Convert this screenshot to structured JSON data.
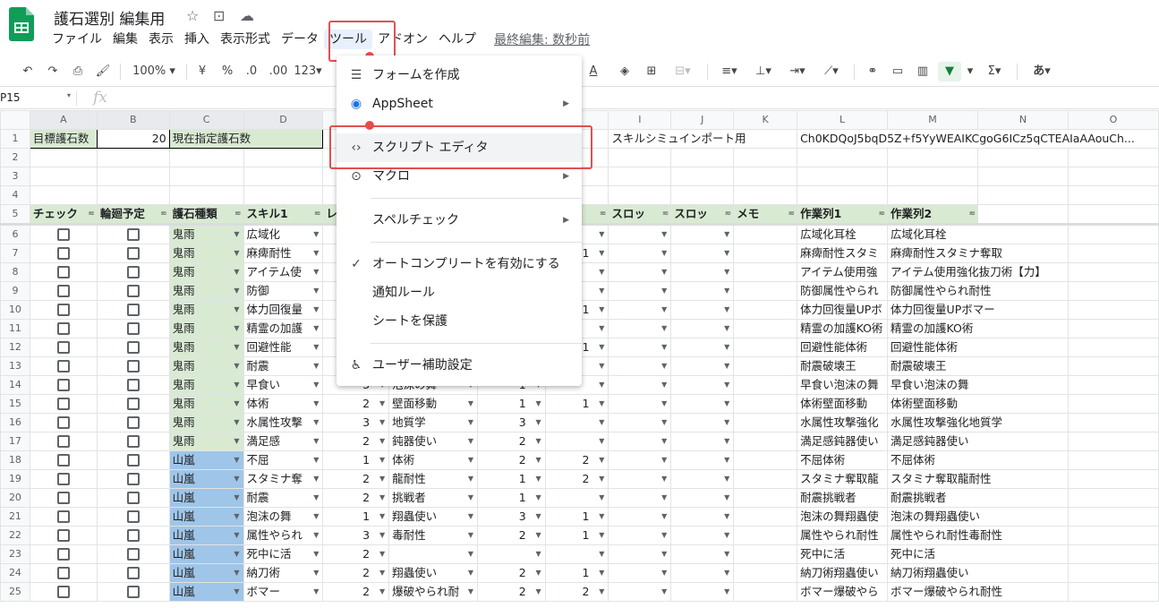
{
  "app": {
    "title": "護石選別 編集用",
    "last_edit": "最終編集: 数秒前"
  },
  "menubar": [
    "ファイル",
    "編集",
    "表示",
    "挿入",
    "表示形式",
    "データ",
    "ツール",
    "アドオン",
    "ヘルプ"
  ],
  "toolbar": {
    "zoom": "100%",
    "currency": "¥",
    "percent": "%",
    "dec_less": ".0",
    "dec_more": ".00",
    "format_more": "123",
    "ime": "あ"
  },
  "formula_bar": {
    "cell_ref": "P15",
    "fx": "fx"
  },
  "columns": [
    "A",
    "B",
    "C",
    "D",
    "E",
    "F",
    "G",
    "H",
    "I",
    "J",
    "K",
    "L",
    "M",
    "N",
    "O"
  ],
  "top_rows": {
    "r1": {
      "a": "目標護石数",
      "b": "20",
      "c": "現在指定護石数",
      "i": "スキルシミュインポート用",
      "l": "Ch0KDQoJ5bqD5Z+f5YyWEAIKCgoG6ICz5qCTEAIaAAouCh..."
    }
  },
  "header_row": [
    "チェック",
    "輪廻予定",
    "護石種類",
    "スキル1",
    "レ",
    "",
    "",
    "ト",
    "スロッ",
    "スロッ",
    "メモ",
    "作業列1",
    "作業列2"
  ],
  "rows": [
    {
      "n": "6",
      "type": "鬼雨",
      "s1": "広域化",
      "l1": "",
      "s2": "",
      "l2": "",
      "l3": "",
      "w1": "広域化耳栓",
      "w2": "広域化耳栓"
    },
    {
      "n": "7",
      "type": "鬼雨",
      "s1": "麻痺耐性",
      "l1": "",
      "s2": "",
      "l2": "",
      "l3": "1",
      "w1": "麻痺耐性スタミ",
      "w2": "麻痺耐性スタミナ奪取"
    },
    {
      "n": "8",
      "type": "鬼雨",
      "s1": "アイテム使",
      "l1": "",
      "s2": "",
      "l2": "",
      "l3": "",
      "w1": "アイテム使用強",
      "w2": "アイテム使用強化抜刀術【力】"
    },
    {
      "n": "9",
      "type": "鬼雨",
      "s1": "防御",
      "l1": "",
      "s2": "",
      "l2": "",
      "l3": "",
      "w1": "防御属性やられ",
      "w2": "防御属性やられ耐性"
    },
    {
      "n": "10",
      "type": "鬼雨",
      "s1": "体力回復量",
      "l1": "",
      "s2": "",
      "l2": "",
      "l3": "1",
      "w1": "体力回復量UPボ",
      "w2": "体力回復量UPボマー"
    },
    {
      "n": "11",
      "type": "鬼雨",
      "s1": "精霊の加護",
      "l1": "",
      "s2": "",
      "l2": "",
      "l3": "",
      "w1": "精霊の加護KO術",
      "w2": "精霊の加護KO術"
    },
    {
      "n": "12",
      "type": "鬼雨",
      "s1": "回避性能",
      "l1": "",
      "s2": "",
      "l2": "",
      "l3": "1",
      "w1": "回避性能体術",
      "w2": "回避性能体術"
    },
    {
      "n": "13",
      "type": "鬼雨",
      "s1": "耐震",
      "l1": "",
      "s2": "",
      "l2": "",
      "l3": "",
      "w1": "耐震破壊王",
      "w2": "耐震破壊王"
    },
    {
      "n": "14",
      "type": "鬼雨",
      "s1": "早食い",
      "l1": "3",
      "s2": "泡沫の舞",
      "l2": "1",
      "l3": "",
      "w1": "早食い泡沫の舞",
      "w2": "早食い泡沫の舞"
    },
    {
      "n": "15",
      "type": "鬼雨",
      "s1": "体術",
      "l1": "2",
      "s2": "壁面移動",
      "l2": "1",
      "l3": "1",
      "w1": "体術壁面移動",
      "w2": "体術壁面移動"
    },
    {
      "n": "16",
      "type": "鬼雨",
      "s1": "水属性攻撃",
      "l1": "3",
      "s2": "地質学",
      "l2": "3",
      "l3": "",
      "w1": "水属性攻撃強化",
      "w2": "水属性攻撃強化地質学"
    },
    {
      "n": "17",
      "type": "鬼雨",
      "s1": "満足感",
      "l1": "2",
      "s2": "鈍器使い",
      "l2": "2",
      "l3": "",
      "w1": "満足感鈍器使い",
      "w2": "満足感鈍器使い"
    },
    {
      "n": "18",
      "type": "山嵐",
      "s1": "不屈",
      "l1": "1",
      "s2": "体術",
      "l2": "2",
      "l3": "2",
      "w1": "不屈体術",
      "w2": "不屈体術"
    },
    {
      "n": "19",
      "type": "山嵐",
      "s1": "スタミナ奪",
      "l1": "2",
      "s2": "龍耐性",
      "l2": "1",
      "l3": "2",
      "w1": "スタミナ奪取龍",
      "w2": "スタミナ奪取龍耐性"
    },
    {
      "n": "20",
      "type": "山嵐",
      "s1": "耐震",
      "l1": "2",
      "s2": "挑戦者",
      "l2": "1",
      "l3": "",
      "w1": "耐震挑戦者",
      "w2": "耐震挑戦者"
    },
    {
      "n": "21",
      "type": "山嵐",
      "s1": "泡沫の舞",
      "l1": "1",
      "s2": "翔蟲使い",
      "l2": "3",
      "l3": "1",
      "w1": "泡沫の舞翔蟲使",
      "w2": "泡沫の舞翔蟲使い"
    },
    {
      "n": "22",
      "type": "山嵐",
      "s1": "属性やられ",
      "l1": "3",
      "s2": "毒耐性",
      "l2": "2",
      "l3": "1",
      "w1": "属性やられ耐性",
      "w2": "属性やられ耐性毒耐性"
    },
    {
      "n": "23",
      "type": "山嵐",
      "s1": "死中に活",
      "l1": "2",
      "s2": "",
      "l2": "",
      "l3": "",
      "w1": "死中に活",
      "w2": "死中に活"
    },
    {
      "n": "24",
      "type": "山嵐",
      "s1": "納刀術",
      "l1": "2",
      "s2": "翔蟲使い",
      "l2": "2",
      "l3": "1",
      "w1": "納刀術翔蟲使い",
      "w2": "納刀術翔蟲使い"
    },
    {
      "n": "25",
      "type": "山嵐",
      "s1": "ボマー",
      "l1": "2",
      "s2": "爆破やられ耐",
      "l2": "2",
      "l3": "2",
      "w1": "ボマー爆破やら",
      "w2": "ボマー爆破やられ耐性"
    }
  ],
  "tools_menu": {
    "items": [
      {
        "label": "フォームを作成",
        "icon": "form-icon"
      },
      {
        "label": "AppSheet",
        "icon": "appsheet-icon"
      },
      {
        "label": "スクリプト エディタ",
        "icon": "code-icon"
      },
      {
        "label": "マクロ",
        "icon": "macro-icon"
      },
      {
        "label": "スペルチェック"
      },
      {
        "label": "オートコンプリートを有効にする",
        "icon": "check-icon"
      },
      {
        "label": "通知ルール"
      },
      {
        "label": "シートを保護"
      },
      {
        "label": "ユーザー補助設定",
        "icon": "accessibility-icon"
      }
    ]
  },
  "colors": {
    "green_fill": "#d9ead3",
    "blue_fill": "#9fc5e8",
    "annotation_red": "#e05050",
    "filter_green": "#188038"
  }
}
